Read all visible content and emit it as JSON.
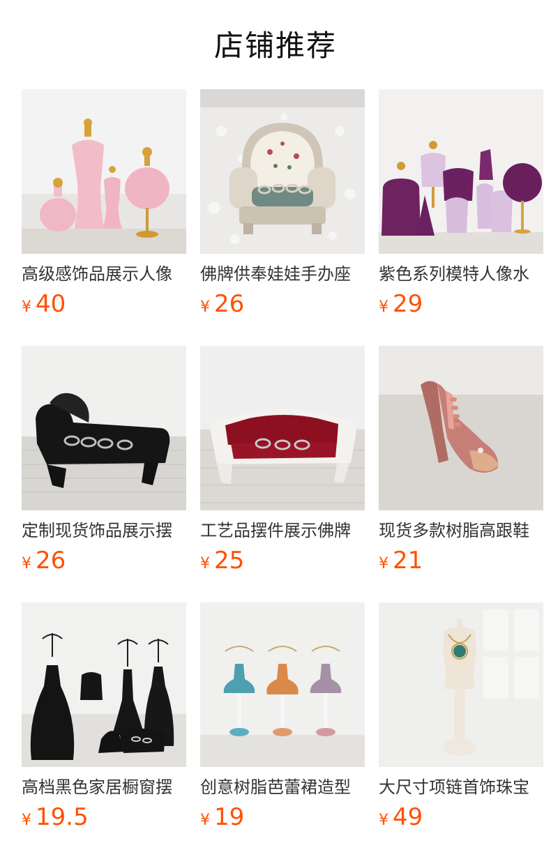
{
  "section": {
    "title": "店铺推荐"
  },
  "products": [
    {
      "title": "高级感饰品展示人像",
      "currency": "¥",
      "price": "40",
      "image": "pink-velvet-mannequin-busts-image"
    },
    {
      "title": "佛牌供奉娃娃手办座",
      "currency": "¥",
      "price": "26",
      "image": "floral-baroque-armchair-ring-holder-image"
    },
    {
      "title": "紫色系列模特人像水",
      "currency": "¥",
      "price": "29",
      "image": "purple-velvet-jewelry-displays-image"
    },
    {
      "title": "定制现货饰品展示摆",
      "currency": "¥",
      "price": "26",
      "image": "black-chaise-lounge-ring-holder-image"
    },
    {
      "title": "工艺品摆件展示佛牌",
      "currency": "¥",
      "price": "25",
      "image": "red-sofa-ring-holder-image"
    },
    {
      "title": "现货多款树脂高跟鞋",
      "currency": "¥",
      "price": "21",
      "image": "pink-high-heel-ring-holder-image"
    },
    {
      "title": "高档黑色家居橱窗摆",
      "currency": "¥",
      "price": "19.5",
      "image": "black-dress-jewelry-stands-image"
    },
    {
      "title": "创意树脂芭蕾裙造型",
      "currency": "¥",
      "price": "19",
      "image": "ballet-dress-jewelry-trees-image"
    },
    {
      "title": "大尺寸项链首饰珠宝",
      "currency": "¥",
      "price": "49",
      "image": "cream-necklace-mannequin-image"
    }
  ]
}
